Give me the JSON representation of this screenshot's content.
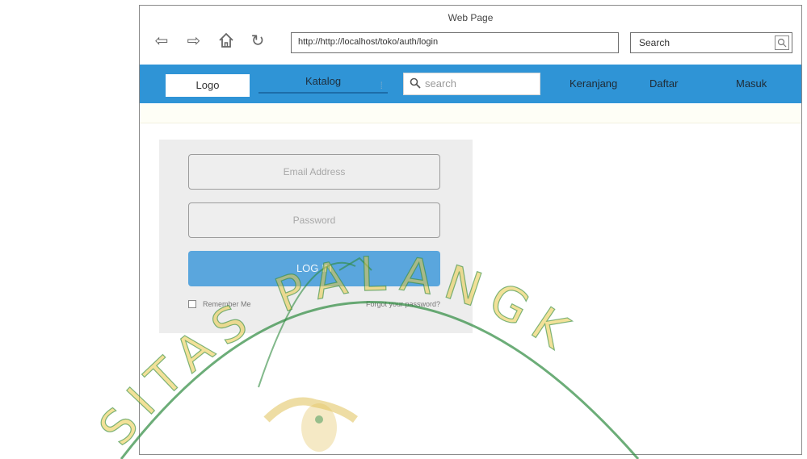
{
  "window": {
    "title": "Web Page"
  },
  "browser": {
    "url": "http://http://localhost/toko/auth/login",
    "search_text": "Search",
    "icons": [
      "back-arrow-icon",
      "forward-arrow-icon",
      "home-icon",
      "refresh-icon",
      "search-icon"
    ]
  },
  "navbar": {
    "bg_color": "#2f94d6",
    "logo": "Logo",
    "katalog": "Katalog",
    "search_placeholder": "search",
    "links": [
      "Keranjang",
      "Daftar",
      "Masuk"
    ]
  },
  "login": {
    "email_placeholder": "Email Address",
    "password_placeholder": "Password",
    "login_button": "LOG IN",
    "remember_label": "Remember Me",
    "forgot_label": "Forgot your password?",
    "button_color": "#5aa6dd"
  },
  "watermark": {
    "text": "SITAS PALANGK",
    "color": "#e8c845"
  }
}
